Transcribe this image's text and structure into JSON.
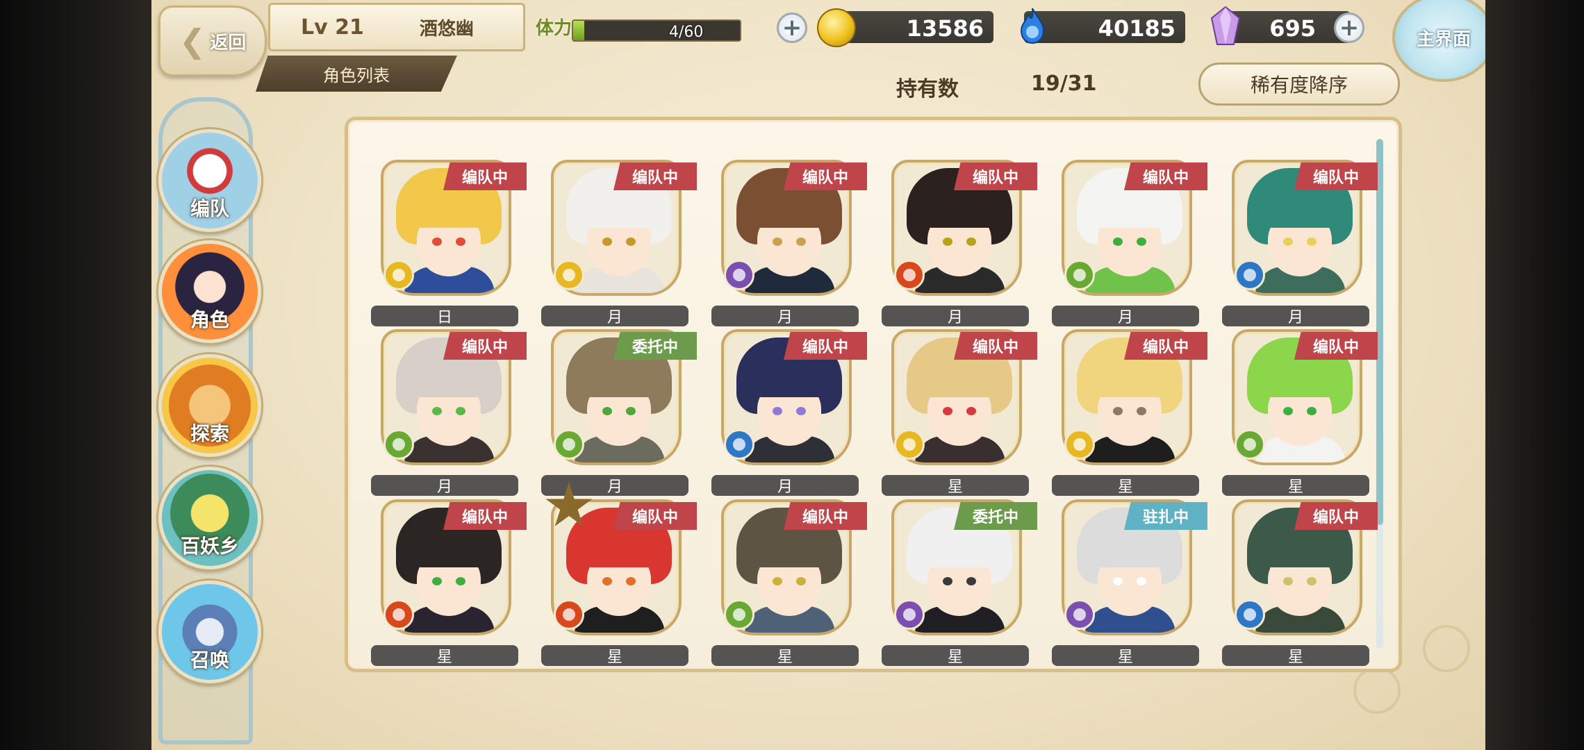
{
  "topbar": {
    "back_label": "返回",
    "level": "Lv 21",
    "player_name": "酒悠幽",
    "list_tab": "角色列表",
    "stamina_label": "体力",
    "stamina_value": "4/60",
    "stamina_fraction": 0.067,
    "coins": "13586",
    "souls": "40185",
    "gems": "695",
    "home_label": "主界面"
  },
  "sidebar": {
    "items": [
      {
        "label": "编队",
        "icon": "team-icon"
      },
      {
        "label": "角色",
        "icon": "character-icon"
      },
      {
        "label": "探索",
        "icon": "explore-icon"
      },
      {
        "label": "百妖乡",
        "icon": "village-icon"
      },
      {
        "label": "召唤",
        "icon": "summon-icon"
      }
    ]
  },
  "header": {
    "owned_label": "持有数",
    "owned_value": "19/31",
    "sort_label": "稀有度降序"
  },
  "colors": {
    "tag_team": "#c0454a",
    "tag_commission": "#6b9b4b",
    "tag_station": "#5fb1c4",
    "elem_sun": "#e8b823",
    "elem_moon": "#7b4fae",
    "elem_fire": "#d8481c",
    "elem_wind": "#6aa834",
    "elem_water": "#2e76c6",
    "name_bar": "#565453"
  },
  "characters": [
    {
      "name": "日",
      "tag": "编队中",
      "element": "sun"
    },
    {
      "name": "月",
      "tag": "编队中",
      "element": "sun"
    },
    {
      "name": "月",
      "tag": "编队中",
      "element": "moon"
    },
    {
      "name": "月",
      "tag": "编队中",
      "element": "fire"
    },
    {
      "name": "月",
      "tag": "编队中",
      "element": "wind"
    },
    {
      "name": "月",
      "tag": "编队中",
      "element": "water"
    },
    {
      "name": "月",
      "tag": "编队中",
      "element": "wind"
    },
    {
      "name": "月",
      "tag": "委托中",
      "element": "wind"
    },
    {
      "name": "月",
      "tag": "编队中",
      "element": "water"
    },
    {
      "name": "星",
      "tag": "编队中",
      "element": "sun"
    },
    {
      "name": "星",
      "tag": "编队中",
      "element": "sun"
    },
    {
      "name": "星",
      "tag": "编队中",
      "element": "wind"
    },
    {
      "name": "星",
      "tag": "编队中",
      "element": "fire"
    },
    {
      "name": "星",
      "tag": "编队中",
      "element": "fire"
    },
    {
      "name": "星",
      "tag": "编队中",
      "element": "wind"
    },
    {
      "name": "星",
      "tag": "委托中",
      "element": "moon"
    },
    {
      "name": "星",
      "tag": "驻扎中",
      "element": "moon"
    },
    {
      "name": "星",
      "tag": "编队中",
      "element": "water"
    }
  ]
}
